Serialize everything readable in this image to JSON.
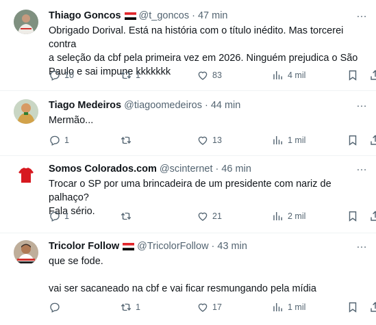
{
  "tweets": [
    {
      "name": "Thiago Goncos",
      "handle": "@t_goncos",
      "separator": "·",
      "time": "47 min",
      "text": "Obrigado Dorival. Está na história com o título inédito. Mas torcerei contra\na seleção da cbf pela primeira vez em 2026. Ninguém prejudica o São\nPaulo e sai impune kkkkkkk",
      "replies": "10",
      "retweets": "1",
      "likes": "83",
      "views": "4 mil",
      "avatar_colors": [
        "#7a8b7d",
        "#e9e4dc"
      ],
      "more_icon": "…"
    },
    {
      "name": "Tiago Medeiros",
      "handle": "@tiagoomedeiros",
      "separator": "·",
      "time": "44 min",
      "text": "Mermão...",
      "replies": "1",
      "retweets": "",
      "likes": "13",
      "views": "1 mil",
      "avatar_colors": [
        "#d9a26a",
        "#2e7d32"
      ],
      "more_icon": "…"
    },
    {
      "name": "Somos Colorados.com",
      "handle": "@scinternet",
      "separator": "·",
      "time": "46 min",
      "text": "Trocar o SP por uma brincadeira de um presidente com nariz de palhaço?\nFala sério.",
      "replies": "1",
      "retweets": "",
      "likes": "21",
      "views": "2 mil",
      "avatar_colors": [
        "#ffffff",
        "#d71920"
      ],
      "more_icon": "…"
    },
    {
      "name": "Tricolor Follow",
      "handle": "@TricolorFollow",
      "separator": "·",
      "time": "43 min",
      "text": "que se fode.\n\nvai ser sacaneado na cbf e vai ficar resmungando pela mídia",
      "replies": "",
      "retweets": "1",
      "likes": "17",
      "views": "1 mil",
      "avatar_colors": [
        "#b7a38e",
        "#3a3a3a"
      ],
      "more_icon": "…"
    }
  ],
  "colors": {
    "text": "#0f1419",
    "muted": "#536471",
    "divider": "#eff3f4",
    "flag_red": "#e1252a",
    "flag_black": "#000000"
  }
}
